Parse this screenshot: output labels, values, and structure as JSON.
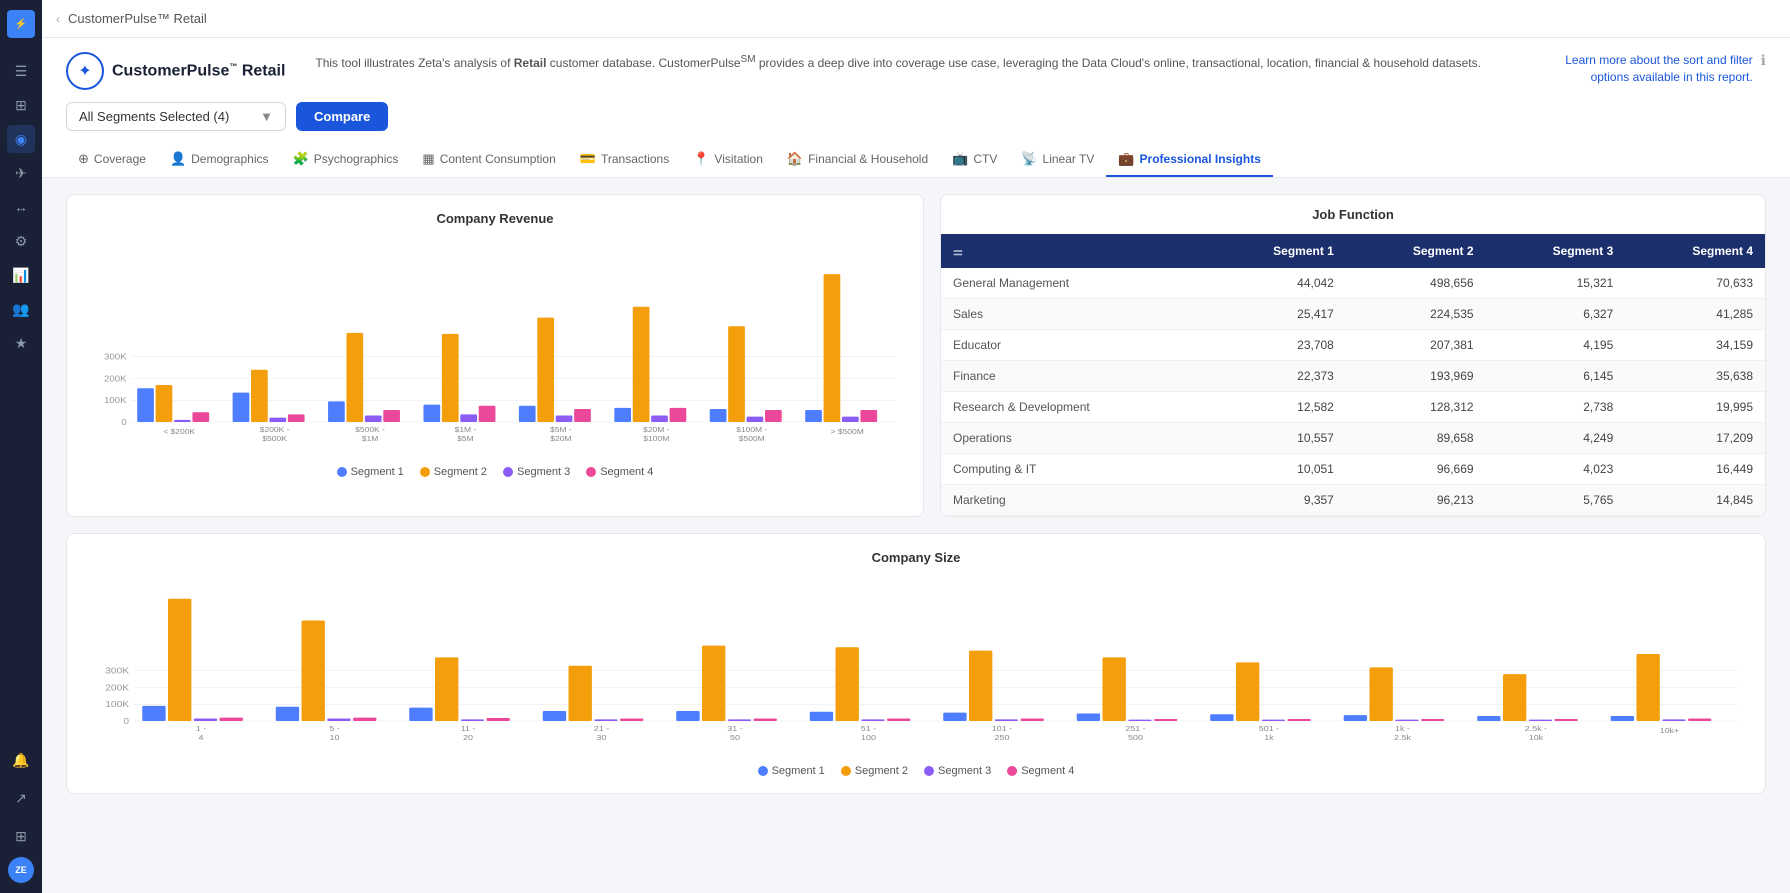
{
  "app": {
    "title": "CustomerPulse™ Retail",
    "logo_text": "CustomerPulse",
    "logo_sup": "™",
    "logo_subtitle": "Retail"
  },
  "header": {
    "description_prefix": "This tool illustrates Zeta's analysis of ",
    "description_brand": "Retail",
    "description_middle": " customer database. CustomerPulse",
    "description_sup": "SM",
    "description_suffix": " provides a deep dive into coverage use case, leveraging the Data Cloud's online, transactional, location, financial & household datasets.",
    "link_text": "Learn more about the sort and filter options available in this report."
  },
  "toolbar": {
    "segment_select_label": "All Segments Selected (4)",
    "compare_btn": "Compare"
  },
  "nav_tabs": [
    {
      "id": "coverage",
      "label": "Coverage",
      "icon": "⊕"
    },
    {
      "id": "demographics",
      "label": "Demographics",
      "icon": "👥"
    },
    {
      "id": "psychographics",
      "label": "Psychographics",
      "icon": "🧠"
    },
    {
      "id": "content",
      "label": "Content Consumption",
      "icon": "📊"
    },
    {
      "id": "transactions",
      "label": "Transactions",
      "icon": "💳"
    },
    {
      "id": "visitation",
      "label": "Visitation",
      "icon": "📍"
    },
    {
      "id": "financial",
      "label": "Financial & Household",
      "icon": "🏠"
    },
    {
      "id": "ctv",
      "label": "CTV",
      "icon": "📺"
    },
    {
      "id": "linear",
      "label": "Linear TV",
      "icon": "📡"
    },
    {
      "id": "professional",
      "label": "Professional Insights",
      "icon": "💼"
    }
  ],
  "company_revenue": {
    "title": "Company Revenue",
    "y_labels": [
      "300K",
      "200K",
      "100K",
      "0"
    ],
    "x_labels": [
      "< $200K",
      "$200K - $500K",
      "$500K - $1M",
      "$1M - $5M",
      "$5M - $20M",
      "$20M - $100M",
      "$100M - $500M",
      "> $500M"
    ],
    "segments": [
      {
        "name": "Segment 1",
        "color": "#4e7eff"
      },
      {
        "name": "Segment 2",
        "color": "#f59e0b"
      },
      {
        "name": "Segment 3",
        "color": "#8b5cf6"
      },
      {
        "name": "Segment 4",
        "color": "#ec4899"
      }
    ],
    "groups": [
      {
        "label": "< $200K",
        "s1": 155,
        "s2": 170,
        "s3": 10,
        "s4": 45
      },
      {
        "label": "$200K-$500K",
        "s1": 135,
        "s2": 240,
        "s3": 20,
        "s4": 35
      },
      {
        "label": "$500K-$1M",
        "s1": 95,
        "s2": 410,
        "s3": 30,
        "s4": 55
      },
      {
        "label": "$1M-$5M",
        "s1": 80,
        "s2": 405,
        "s3": 35,
        "s4": 75
      },
      {
        "label": "$5M-$20M",
        "s1": 75,
        "s2": 480,
        "s3": 30,
        "s4": 60
      },
      {
        "label": "$20M-$100M",
        "s1": 65,
        "s2": 530,
        "s3": 30,
        "s4": 65
      },
      {
        "label": "$100M-$500M",
        "s1": 60,
        "s2": 440,
        "s3": 25,
        "s4": 55
      },
      {
        "label": "> $500M",
        "s1": 55,
        "s2": 680,
        "s3": 25,
        "s4": 55
      }
    ],
    "max_val": 800
  },
  "job_function": {
    "title": "Job Function",
    "headers": [
      "",
      "Segment 1",
      "Segment 2",
      "Segment 3",
      "Segment 4"
    ],
    "rows": [
      {
        "label": "General Management",
        "s1": "44,042",
        "s2": "498,656",
        "s3": "15,321",
        "s4": "70,633"
      },
      {
        "label": "Sales",
        "s1": "25,417",
        "s2": "224,535",
        "s3": "6,327",
        "s4": "41,285"
      },
      {
        "label": "Educator",
        "s1": "23,708",
        "s2": "207,381",
        "s3": "4,195",
        "s4": "34,159"
      },
      {
        "label": "Finance",
        "s1": "22,373",
        "s2": "193,969",
        "s3": "6,145",
        "s4": "35,638"
      },
      {
        "label": "Research & Development",
        "s1": "12,582",
        "s2": "128,312",
        "s3": "2,738",
        "s4": "19,995"
      },
      {
        "label": "Operations",
        "s1": "10,557",
        "s2": "89,658",
        "s3": "4,249",
        "s4": "17,209"
      },
      {
        "label": "Computing & IT",
        "s1": "10,051",
        "s2": "96,669",
        "s3": "4,023",
        "s4": "16,449"
      },
      {
        "label": "Marketing",
        "s1": "9,357",
        "s2": "96,213",
        "s3": "5,765",
        "s4": "14,845"
      }
    ]
  },
  "company_size": {
    "title": "Company Size",
    "x_labels": [
      "1 - 4",
      "5 - 10",
      "11 - 20",
      "21 - 30",
      "31 - 50",
      "51 - 100",
      "101 - 250",
      "251 - 500",
      "501 - 1k",
      "1k - 2.5k",
      "2.5k - 10k",
      "10k+"
    ],
    "groups": [
      {
        "s1": 90,
        "s2": 730,
        "s3": 15,
        "s4": 20
      },
      {
        "s1": 85,
        "s2": 600,
        "s3": 15,
        "s4": 20
      },
      {
        "s1": 80,
        "s2": 380,
        "s3": 10,
        "s4": 18
      },
      {
        "s1": 60,
        "s2": 330,
        "s3": 10,
        "s4": 15
      },
      {
        "s1": 60,
        "s2": 450,
        "s3": 10,
        "s4": 15
      },
      {
        "s1": 55,
        "s2": 440,
        "s3": 10,
        "s4": 15
      },
      {
        "s1": 50,
        "s2": 420,
        "s3": 10,
        "s4": 15
      },
      {
        "s1": 45,
        "s2": 380,
        "s3": 8,
        "s4": 12
      },
      {
        "s1": 40,
        "s2": 350,
        "s3": 8,
        "s4": 12
      },
      {
        "s1": 35,
        "s2": 320,
        "s3": 8,
        "s4": 12
      },
      {
        "s1": 30,
        "s2": 280,
        "s3": 8,
        "s4": 12
      },
      {
        "s1": 30,
        "s2": 400,
        "s3": 10,
        "s4": 15
      }
    ],
    "max_val": 800,
    "segments": [
      {
        "name": "Segment 1",
        "color": "#4e7eff"
      },
      {
        "name": "Segment 2",
        "color": "#f59e0b"
      },
      {
        "name": "Segment 3",
        "color": "#8b5cf6"
      },
      {
        "name": "Segment 4",
        "color": "#ec4899"
      }
    ]
  },
  "sidebar": {
    "icons": [
      "☰",
      "⊕",
      "◎",
      "✈",
      "↔",
      "⚙",
      "📊",
      "🔔"
    ],
    "avatar_initials": "ZE"
  }
}
